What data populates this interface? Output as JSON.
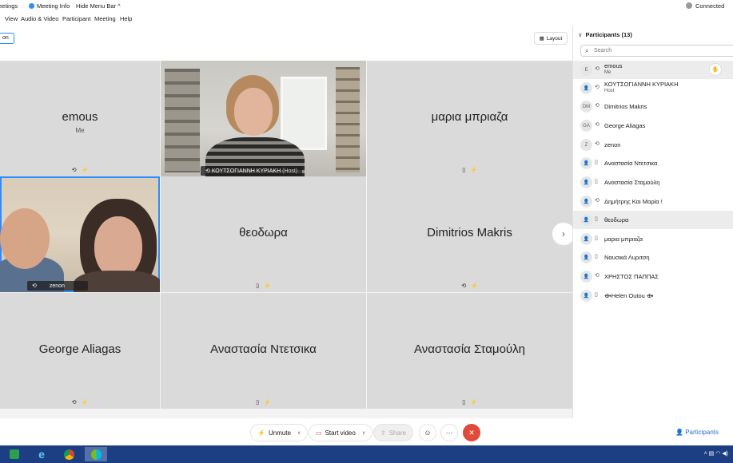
{
  "titlebar": {
    "app_fragment": "eetings",
    "meeting_info": "Meeting Info",
    "hide_menu": "Hide Menu Bar",
    "status": "Connected"
  },
  "menu": {
    "items": [
      "View",
      "Audio & Video",
      "Participant",
      "Meeting",
      "Help"
    ]
  },
  "view_tag": "on",
  "layout_label": "Layout",
  "tiles": [
    {
      "name": "emous",
      "sub": "Me"
    },
    {
      "label": "ΚΟΥΤΣΟΓΙΑΝΝΗ ΚΥΡΙΑΚΗ",
      "label_sub": "(Host)"
    },
    {
      "name": "μαρια μπριαζα"
    },
    {
      "label": "zenon"
    },
    {
      "name": "θεοδωρα"
    },
    {
      "name": "Dimitrios Makris"
    },
    {
      "name": "George Aliagas"
    },
    {
      "name": "Αναστασία Ντετσικα"
    },
    {
      "name": "Αναστασία Σταμούλη"
    }
  ],
  "panel": {
    "title": "Participants (13)",
    "search_placeholder": "Search",
    "participants": [
      {
        "initials": "E",
        "name": "emous",
        "sub": "Me"
      },
      {
        "initials": "",
        "name": "ΚΟΥΤΣΟΓΙΑΝΝΗ ΚΥΡΙΑΚΗ",
        "sub": "Host"
      },
      {
        "initials": "DM",
        "name": "Dimitrios Makris"
      },
      {
        "initials": "GA",
        "name": "George Aliagas"
      },
      {
        "initials": "Z",
        "name": "zenon"
      },
      {
        "initials": "",
        "name": "Αναστασία Ντετσικα"
      },
      {
        "initials": "",
        "name": "Αναστασία Σταμούλη"
      },
      {
        "initials": "",
        "name": "Δημήτρης Και Μαρία !"
      },
      {
        "initials": "",
        "name": "θεοδωρα"
      },
      {
        "initials": "",
        "name": "μαρια μπριαζα"
      },
      {
        "initials": "",
        "name": "Ναυσικά Λυριτση"
      },
      {
        "initials": "",
        "name": "ΧΡΗΣΤΟΣ ΠΑΠΠΑΣ"
      },
      {
        "initials": "",
        "name": "Helen Outou"
      }
    ]
  },
  "controls": {
    "unmute": "Unmute",
    "start_video": "Start video",
    "share": "Share",
    "participants": "Participants"
  },
  "colors": {
    "accent": "#2d8cff",
    "end": "#e04a3b",
    "taskbar": "#1b3f82",
    "muted_mic": "#e02828"
  }
}
